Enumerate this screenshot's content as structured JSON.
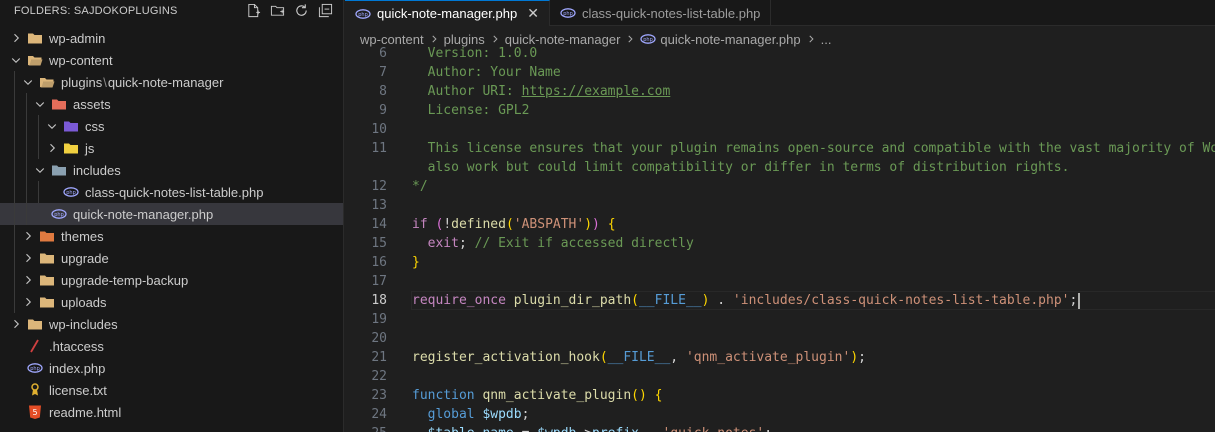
{
  "sidebar": {
    "title": "FOLDERS: SAJDOKOPLUGINS",
    "tree": [
      {
        "label": "wp-admin",
        "depth": 0,
        "chev": "right",
        "icon": "folder-icon",
        "color": "#dcb67a"
      },
      {
        "label": "wp-content",
        "depth": 0,
        "chev": "down",
        "icon": "folder-open-icon",
        "color": "#dcb67a"
      },
      {
        "label": "plugins",
        "label2": "quick-note-manager",
        "depth": 1,
        "chev": "down",
        "icon": "folder-open-icon",
        "color": "#dcb67a"
      },
      {
        "label": "assets",
        "depth": 2,
        "chev": "down",
        "icon": "assets-folder-icon",
        "color": "#e46d5a"
      },
      {
        "label": "css",
        "depth": 3,
        "chev": "down",
        "icon": "css-folder-icon",
        "color": "#7b5ad6"
      },
      {
        "label": "js",
        "depth": 3,
        "chev": "right",
        "icon": "js-folder-icon",
        "color": "#f0d040"
      },
      {
        "label": "includes",
        "depth": 2,
        "chev": "down",
        "icon": "includes-folder-icon",
        "color": "#8aa0b0"
      },
      {
        "label": "class-quick-notes-list-table.php",
        "depth": 3,
        "chev": "none",
        "icon": "php-file-icon",
        "color": "#a0a8ff"
      },
      {
        "label": "quick-note-manager.php",
        "depth": 2,
        "chev": "none",
        "icon": "php-file-icon",
        "color": "#a0a8ff",
        "selected": true
      },
      {
        "label": "themes",
        "depth": 1,
        "chev": "right",
        "icon": "themes-folder-icon",
        "color": "#e07a40"
      },
      {
        "label": "upgrade",
        "depth": 1,
        "chev": "right",
        "icon": "folder-icon",
        "color": "#dcb67a"
      },
      {
        "label": "upgrade-temp-backup",
        "depth": 1,
        "chev": "right",
        "icon": "folder-icon",
        "color": "#dcb67a"
      },
      {
        "label": "uploads",
        "depth": 1,
        "chev": "right",
        "icon": "folder-icon",
        "color": "#dcb67a"
      },
      {
        "label": "wp-includes",
        "depth": 0,
        "chev": "right",
        "icon": "folder-icon",
        "color": "#dcb67a"
      },
      {
        "label": ".htaccess",
        "depth": 0,
        "chev": "none",
        "icon": "htaccess-file-icon",
        "color": "#d04040"
      },
      {
        "label": "index.php",
        "depth": 0,
        "chev": "none",
        "icon": "php-file-icon",
        "color": "#a0a8ff"
      },
      {
        "label": "license.txt",
        "depth": 0,
        "chev": "none",
        "icon": "license-file-icon",
        "color": "#e0b030"
      },
      {
        "label": "readme.html",
        "depth": 0,
        "chev": "none",
        "icon": "html-file-icon",
        "color": "#e44d26"
      }
    ]
  },
  "tabs": [
    {
      "label": "quick-note-manager.php",
      "active": true,
      "close": "✕"
    },
    {
      "label": "class-quick-notes-list-table.php",
      "active": false
    }
  ],
  "breadcrumb": [
    "wp-content",
    "plugins",
    "quick-note-manager",
    "quick-note-manager.php",
    "..."
  ],
  "editor": {
    "current_line": 18,
    "lines": [
      {
        "n": "6",
        "tokens": [
          {
            "t": "  Version: 1.0.0",
            "c": "t-comment"
          }
        ]
      },
      {
        "n": "7",
        "tokens": [
          {
            "t": "  Author: Your Name",
            "c": "t-comment"
          }
        ]
      },
      {
        "n": "8",
        "tokens": [
          {
            "t": "  Author URI: ",
            "c": "t-comment"
          },
          {
            "t": "https://example.com",
            "c": "t-link"
          }
        ]
      },
      {
        "n": "9",
        "tokens": [
          {
            "t": "  License: GPL2",
            "c": "t-comment"
          }
        ]
      },
      {
        "n": "10",
        "tokens": []
      },
      {
        "n": "11",
        "tokens": [
          {
            "t": "  This license ensures that your plugin remains open-source and compatible with the vast majority of WordPress",
            "c": "t-comment"
          }
        ]
      },
      {
        "n": "",
        "tokens": [
          {
            "t": "  also work but could limit compatibility or differ in terms of distribution rights.",
            "c": "t-comment"
          }
        ]
      },
      {
        "n": "12",
        "tokens": [
          {
            "t": "*/",
            "c": "t-comment"
          }
        ]
      },
      {
        "n": "13",
        "tokens": []
      },
      {
        "n": "14",
        "tokens": [
          {
            "t": "if",
            "c": "t-kw"
          },
          {
            "t": " (",
            "c": "t-brace2"
          },
          {
            "t": "!",
            "c": "t-plain"
          },
          {
            "t": "defined",
            "c": "t-fn"
          },
          {
            "t": "(",
            "c": "t-brace"
          },
          {
            "t": "'ABSPATH'",
            "c": "t-str"
          },
          {
            "t": ")",
            "c": "t-brace"
          },
          {
            "t": ")",
            "c": "t-brace2"
          },
          {
            "t": " {",
            "c": "t-brace"
          }
        ]
      },
      {
        "n": "15",
        "tokens": [
          {
            "t": "  exit",
            "c": "t-kw"
          },
          {
            "t": "; ",
            "c": "t-plain"
          },
          {
            "t": "// Exit if accessed directly",
            "c": "t-comment"
          }
        ]
      },
      {
        "n": "16",
        "tokens": [
          {
            "t": "}",
            "c": "t-brace"
          }
        ]
      },
      {
        "n": "17",
        "tokens": []
      },
      {
        "n": "18",
        "tokens": [
          {
            "t": "require_once",
            "c": "t-kw"
          },
          {
            "t": " ",
            "c": "t-plain"
          },
          {
            "t": "plugin_dir_path",
            "c": "t-fn"
          },
          {
            "t": "(",
            "c": "t-brace"
          },
          {
            "t": "__FILE__",
            "c": "t-kwb"
          },
          {
            "t": ")",
            "c": "t-brace"
          },
          {
            "t": " . ",
            "c": "t-plain"
          },
          {
            "t": "'includes/class-quick-notes-list-table.php'",
            "c": "t-str"
          },
          {
            "t": ";",
            "c": "t-plain"
          }
        ],
        "caret": true
      },
      {
        "n": "19",
        "tokens": []
      },
      {
        "n": "20",
        "tokens": []
      },
      {
        "n": "21",
        "tokens": [
          {
            "t": "register_activation_hook",
            "c": "t-fn"
          },
          {
            "t": "(",
            "c": "t-brace"
          },
          {
            "t": "__FILE__",
            "c": "t-kwb"
          },
          {
            "t": ", ",
            "c": "t-plain"
          },
          {
            "t": "'qnm_activate_plugin'",
            "c": "t-str"
          },
          {
            "t": ")",
            "c": "t-brace"
          },
          {
            "t": ";",
            "c": "t-plain"
          }
        ]
      },
      {
        "n": "22",
        "tokens": []
      },
      {
        "n": "23",
        "tokens": [
          {
            "t": "function",
            "c": "t-kwb"
          },
          {
            "t": " ",
            "c": "t-plain"
          },
          {
            "t": "qnm_activate_plugin",
            "c": "t-fn"
          },
          {
            "t": "()",
            "c": "t-brace"
          },
          {
            "t": " {",
            "c": "t-brace"
          }
        ]
      },
      {
        "n": "24",
        "tokens": [
          {
            "t": "  global",
            "c": "t-kwb"
          },
          {
            "t": " ",
            "c": "t-plain"
          },
          {
            "t": "$wpdb",
            "c": "t-var"
          },
          {
            "t": ";",
            "c": "t-plain"
          }
        ]
      },
      {
        "n": "25",
        "tokens": [
          {
            "t": "  $table_name",
            "c": "t-var"
          },
          {
            "t": " = ",
            "c": "t-plain"
          },
          {
            "t": "$wpdb",
            "c": "t-var"
          },
          {
            "t": "->",
            "c": "t-plain"
          },
          {
            "t": "prefix",
            "c": "t-var"
          },
          {
            "t": " . ",
            "c": "t-plain"
          },
          {
            "t": "'quick_notes'",
            "c": "t-str"
          },
          {
            "t": ";",
            "c": "t-plain"
          }
        ]
      }
    ]
  }
}
